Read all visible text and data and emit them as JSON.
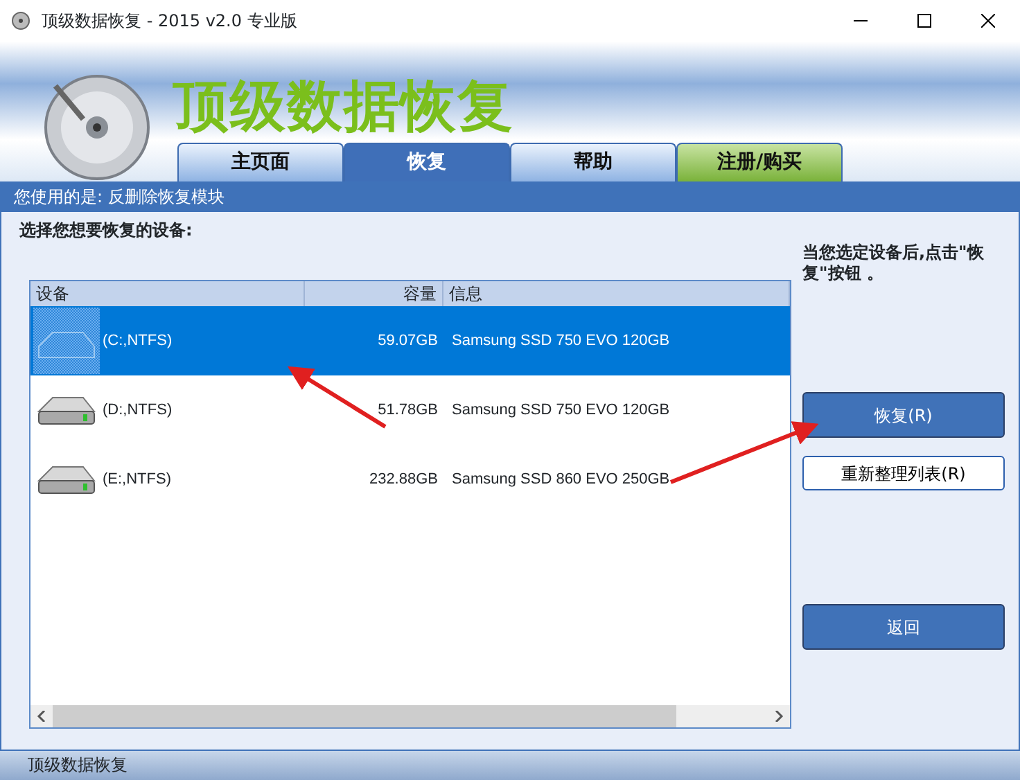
{
  "window": {
    "title": "顶级数据恢复 - 2015 v2.0 专业版"
  },
  "banner": {
    "title": "顶级数据恢复"
  },
  "tabs": [
    {
      "label": "主页面",
      "selected": false,
      "kind": "normal"
    },
    {
      "label": "恢复",
      "selected": true,
      "kind": "normal"
    },
    {
      "label": "帮助",
      "selected": false,
      "kind": "normal"
    },
    {
      "label": "注册/购买",
      "selected": false,
      "kind": "register"
    }
  ],
  "info_bar": "您使用的是: 反删除恢复模块",
  "section_label": "选择您想要恢复的设备:",
  "table": {
    "columns": [
      "设备",
      "容量",
      "信息"
    ],
    "rows": [
      {
        "device": "(C:,NTFS)",
        "capacity": "59.07GB",
        "info": "Samsung SSD 750 EVO 120GB",
        "selected": true
      },
      {
        "device": "(D:,NTFS)",
        "capacity": "51.78GB",
        "info": "Samsung SSD 750 EVO 120GB",
        "selected": false
      },
      {
        "device": "(E:,NTFS)",
        "capacity": "232.88GB",
        "info": "Samsung SSD 860 EVO 250GB",
        "selected": false
      }
    ]
  },
  "hint": "当您选定设备后,点击\"恢复\"按钮 。",
  "buttons": [
    {
      "label": "恢复(R)",
      "kind": "primary"
    },
    {
      "label": "重新整理列表(R)",
      "kind": "outline"
    },
    {
      "label": "返回",
      "kind": "primary"
    }
  ],
  "status_bar": "顶级数据恢复"
}
